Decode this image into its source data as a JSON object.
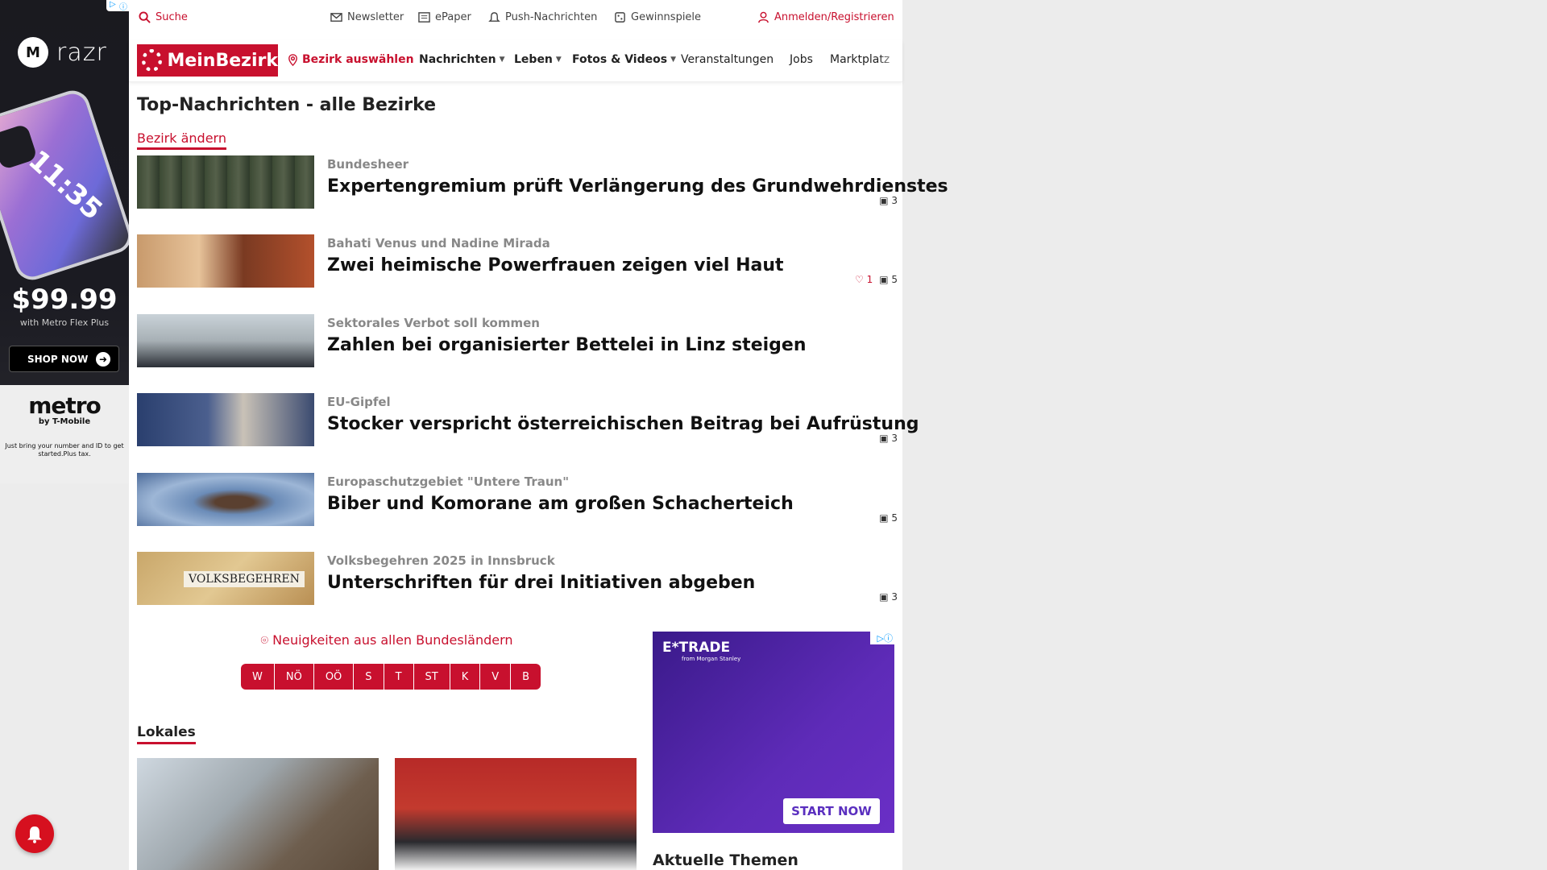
{
  "ad_left": {
    "brand": "razr",
    "phone_time": "11:35",
    "price": "$99.99",
    "subtitle": "with Metro Flex Plus",
    "cta": "SHOP NOW",
    "metro": "metro",
    "metro_by": "by T-Mobile",
    "fine_print": "Just bring your number and ID to get started.Plus tax."
  },
  "topbar": {
    "search": "Suche",
    "newsletter": "Newsletter",
    "epaper": "ePaper",
    "push": "Push-Nachrichten",
    "gewinnspiele": "Gewinnspiele",
    "login": "Anmelden/Registrieren"
  },
  "nav": {
    "logo": "MeinBezirk",
    "bezirk": "Bezirk auswählen",
    "items": [
      "Nachrichten",
      "Leben",
      "Fotos & Videos",
      "Veranstaltungen",
      "Jobs",
      "Marktplatz"
    ]
  },
  "page_title": "Top-Nachrichten - alle Bezirke",
  "change_district": "Bezirk ändern",
  "articles": [
    {
      "kicker": "Bundesheer",
      "headline": "Expertengremium prüft Verlängerung des Grundwehrdienstes",
      "likes": "",
      "images": "3"
    },
    {
      "kicker": "Bahati Venus und Nadine Mirada",
      "headline": "Zwei heimische Powerfrauen zeigen viel Haut",
      "likes": "1",
      "images": "5"
    },
    {
      "kicker": "Sektorales Verbot soll kommen",
      "headline": "Zahlen bei organisierter Bettelei in Linz steigen",
      "likes": "",
      "images": ""
    },
    {
      "kicker": "EU-Gipfel",
      "headline": "Stocker verspricht österreichischen Beitrag bei Aufrüstung",
      "likes": "",
      "images": "3"
    },
    {
      "kicker": "Europaschutzgebiet \"Untere Traun\"",
      "headline": "Biber und Komorane am großen Schacherteich",
      "likes": "",
      "images": "5"
    },
    {
      "kicker": "Volksbegehren 2025 in Innsbruck",
      "headline": "Unterschriften für drei Initiativen abgeben",
      "likes": "",
      "images": "3",
      "thumb_text": "VOLKSBEGEHREN"
    }
  ],
  "regions_title": "Neuigkeiten aus allen Bundesländern",
  "regions": [
    "W",
    "NÖ",
    "OÖ",
    "S",
    "T",
    "ST",
    "K",
    "V",
    "B"
  ],
  "lokales": "Lokales",
  "ad_right": {
    "brand": "E*TRADE",
    "sub": "from Morgan Stanley",
    "cta": "START NOW"
  },
  "aktuelle": "Aktuelle Themen",
  "colors": {
    "accent": "#c8102e"
  }
}
